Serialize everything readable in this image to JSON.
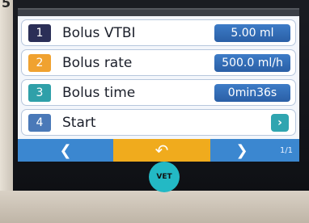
{
  "rows": [
    {
      "num": "1",
      "label": "Bolus VTBI",
      "value": "5.00 ml"
    },
    {
      "num": "2",
      "label": "Bolus rate",
      "value": "500.0 ml/h"
    },
    {
      "num": "3",
      "label": "Bolus time",
      "value": "0min36s"
    },
    {
      "num": "4",
      "label": "Start",
      "value": ""
    }
  ],
  "colors": {
    "num1": "#2b2f57",
    "num2": "#f0a230",
    "num3": "#2fa0a9",
    "num4": "#4a79b8",
    "value_bg": "#2e64ad",
    "nav_bg": "#3b87d0",
    "nav_center": "#f0ab1d",
    "logo": "#23b9c5"
  },
  "nav": {
    "left_icon": "chevron-left-icon",
    "center_icon": "back-arrow-icon",
    "right_icon": "chevron-right-icon",
    "page": "1/1",
    "start_arrow_icon": "chevron-right-icon"
  },
  "logo": {
    "text": "VET"
  },
  "corner_mark": "5"
}
